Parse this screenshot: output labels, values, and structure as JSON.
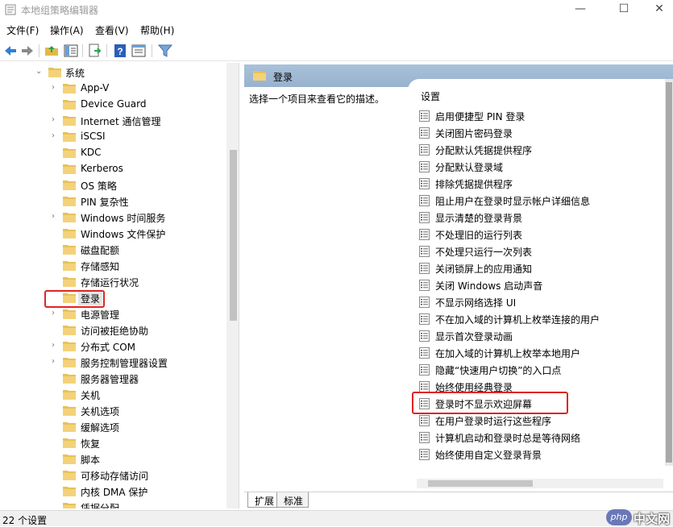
{
  "window": {
    "title": "本地组策略编辑器",
    "minimize": "—",
    "maximize": "☐",
    "close": "✕"
  },
  "menubar": [
    {
      "label": "文件(F)"
    },
    {
      "label": "操作(A)"
    },
    {
      "label": "查看(V)"
    },
    {
      "label": "帮助(H)"
    }
  ],
  "toolbar": [
    "back-icon",
    "forward-icon",
    "up-folder-icon",
    "show-hide-tree-icon",
    "export-list-icon",
    "help-icon",
    "properties-icon",
    "filter-icon"
  ],
  "tree": {
    "items": [
      {
        "label": "系统",
        "chevron": "⌄",
        "level": 0
      },
      {
        "label": "App-V",
        "chevron": "›",
        "level": 1
      },
      {
        "label": "Device Guard",
        "chevron": "",
        "level": 1
      },
      {
        "label": "Internet 通信管理",
        "chevron": "›",
        "level": 1
      },
      {
        "label": "iSCSI",
        "chevron": "›",
        "level": 1
      },
      {
        "label": "KDC",
        "chevron": "",
        "level": 1
      },
      {
        "label": "Kerberos",
        "chevron": "",
        "level": 1
      },
      {
        "label": "OS 策略",
        "chevron": "",
        "level": 1
      },
      {
        "label": "PIN 复杂性",
        "chevron": "",
        "level": 1
      },
      {
        "label": "Windows 时间服务",
        "chevron": "›",
        "level": 1
      },
      {
        "label": "Windows 文件保护",
        "chevron": "",
        "level": 1
      },
      {
        "label": "磁盘配额",
        "chevron": "",
        "level": 1
      },
      {
        "label": "存储感知",
        "chevron": "",
        "level": 1
      },
      {
        "label": "存储运行状况",
        "chevron": "",
        "level": 1
      },
      {
        "label": "登录",
        "chevron": "",
        "level": 1,
        "selected": true
      },
      {
        "label": "电源管理",
        "chevron": "›",
        "level": 1
      },
      {
        "label": "访问被拒绝协助",
        "chevron": "",
        "level": 1
      },
      {
        "label": "分布式 COM",
        "chevron": "›",
        "level": 1
      },
      {
        "label": "服务控制管理器设置",
        "chevron": "›",
        "level": 1
      },
      {
        "label": "服务器管理器",
        "chevron": "",
        "level": 1
      },
      {
        "label": "关机",
        "chevron": "",
        "level": 1
      },
      {
        "label": "关机选项",
        "chevron": "",
        "level": 1
      },
      {
        "label": "缓解选项",
        "chevron": "",
        "level": 1
      },
      {
        "label": "恢复",
        "chevron": "",
        "level": 1
      },
      {
        "label": "脚本",
        "chevron": "",
        "level": 1
      },
      {
        "label": "可移动存储访问",
        "chevron": "",
        "level": 1
      },
      {
        "label": "内核 DMA 保护",
        "chevron": "",
        "level": 1
      },
      {
        "label": "凭据分配",
        "chevron": "",
        "level": 1
      }
    ]
  },
  "right": {
    "header_title": "登录",
    "description": "选择一个项目来查看它的描述。",
    "list_header": "设置",
    "settings": [
      "启用便捷型 PIN 登录",
      "关闭图片密码登录",
      "分配默认凭据提供程序",
      "分配默认登录域",
      "排除凭据提供程序",
      "阻止用户在登录时显示帐户详细信息",
      "显示清楚的登录背景",
      "不处理旧的运行列表",
      "不处理只运行一次列表",
      "关闭锁屏上的应用通知",
      "关闭 Windows 启动声音",
      "不显示网络选择 UI",
      "不在加入域的计算机上枚举连接的用户",
      "显示首次登录动画",
      "在加入域的计算机上枚举本地用户",
      "隐藏“快速用户切换”的入口点",
      "始终使用经典登录",
      "登录时不显示欢迎屏幕",
      "在用户登录时运行这些程序",
      "计算机启动和登录时总是等待网络",
      "始终使用自定义登录背景"
    ],
    "tabs": [
      {
        "label": "扩展",
        "active": true
      },
      {
        "label": "标准",
        "active": false
      }
    ]
  },
  "status": {
    "text": "22 个设置"
  },
  "watermark": {
    "badge": "php",
    "text": "中文网"
  },
  "colors": {
    "highlight": "#e02424",
    "folder": "#e8c15a",
    "header": "#9fb8d4"
  }
}
